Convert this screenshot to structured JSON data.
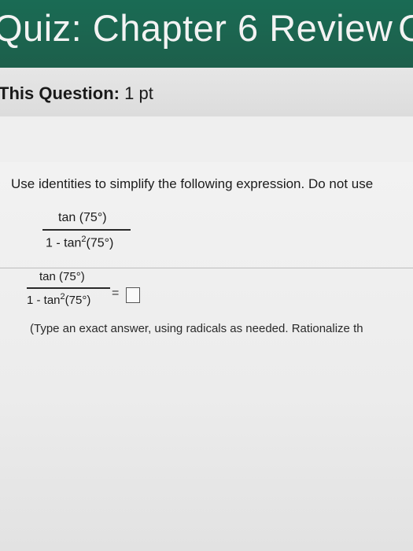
{
  "header": {
    "title": "Quiz: Chapter 6 Review",
    "title_cut": "C"
  },
  "question": {
    "points_label": "This Question:",
    "points_value": "1 pt"
  },
  "problem": {
    "instruction": "Use identities to simplify the following expression. Do not use",
    "numerator": "tan (75°)",
    "denominator_prefix": "1 - tan",
    "denominator_power": "2",
    "denominator_suffix": "(75°)",
    "equals": "=",
    "hint": "(Type an exact answer, using radicals as needed. Rationalize th"
  }
}
